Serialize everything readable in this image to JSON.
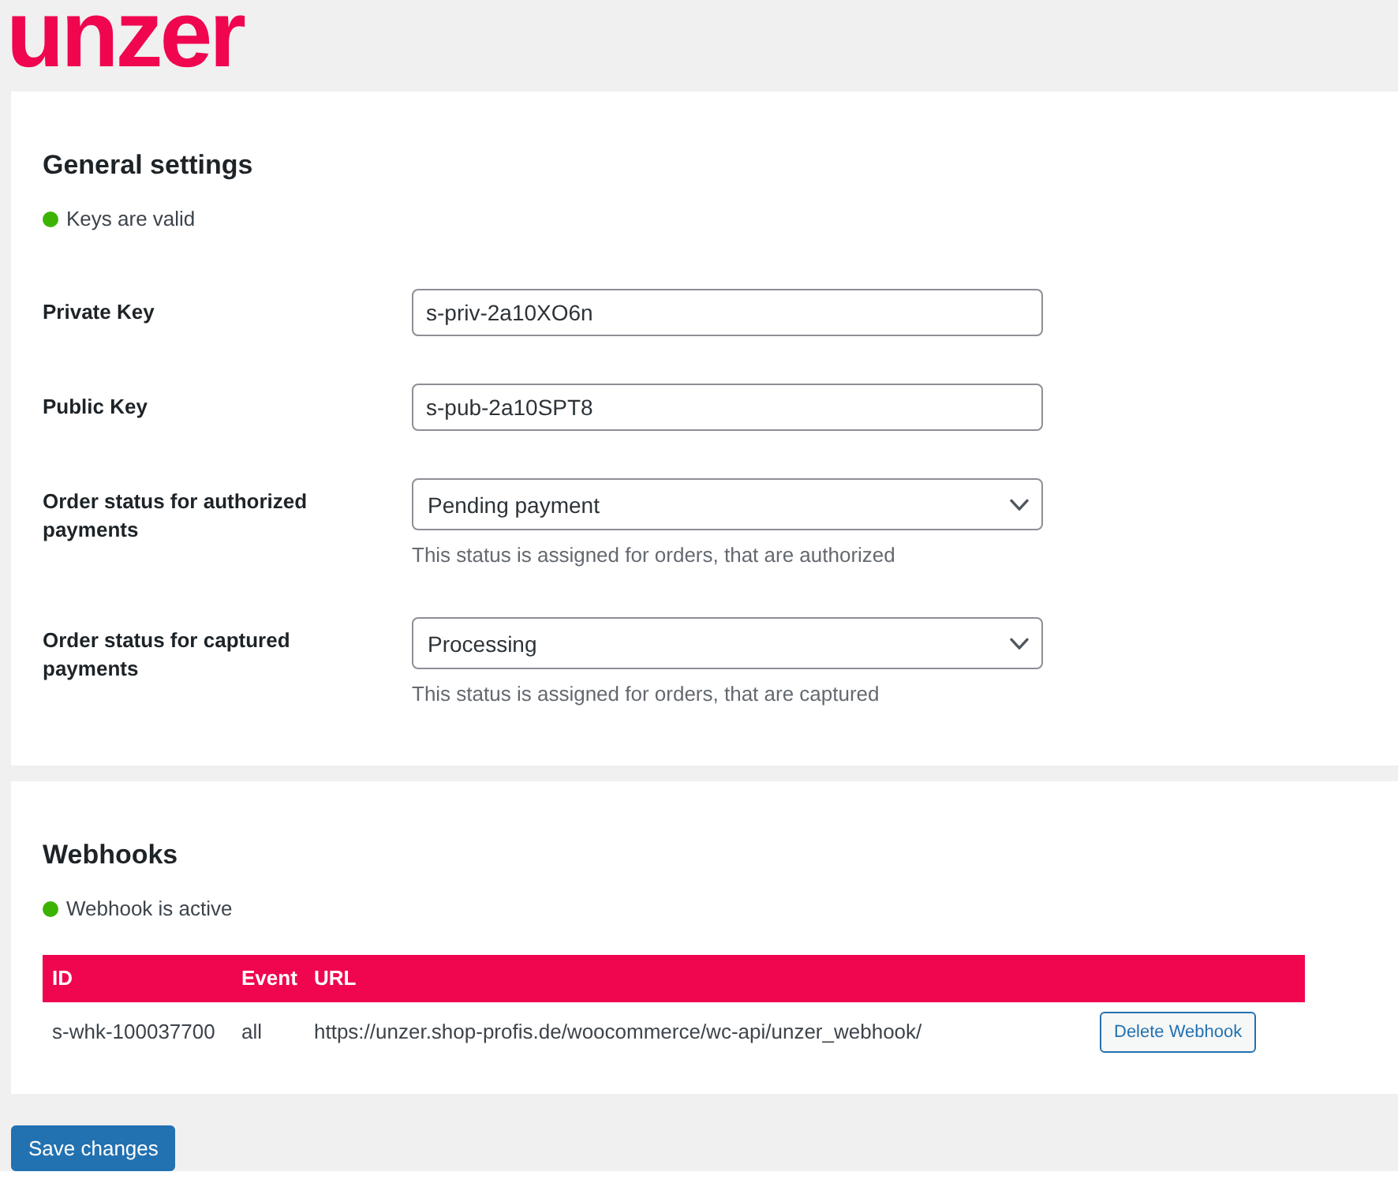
{
  "logo": {
    "text": "unzer"
  },
  "general_settings": {
    "title": "General settings",
    "status": {
      "text": "Keys are valid",
      "ok": true
    },
    "fields": [
      {
        "kind": "text",
        "label": "Private Key",
        "value": "s-priv-2a10XO6n"
      },
      {
        "kind": "text",
        "label": "Public Key",
        "value": "s-pub-2a10SPT8"
      },
      {
        "kind": "select",
        "label": "Order status for authorized payments",
        "value": "Pending payment",
        "description": "This status is assigned for orders, that are authorized"
      },
      {
        "kind": "select",
        "label": "Order status for captured payments",
        "value": "Processing",
        "description": "This status is assigned for orders, that are captured"
      }
    ]
  },
  "webhooks": {
    "title": "Webhooks",
    "status": {
      "text": "Webhook is active",
      "ok": true
    },
    "table": {
      "columns": [
        "ID",
        "Event",
        "URL"
      ],
      "rows": [
        {
          "cells": [
            "s-whk-100037700",
            "all",
            "https://unzer.shop-profis.de/woocommerce/wc-api/unzer_webhook/"
          ],
          "action": "Delete Webhook"
        }
      ]
    }
  },
  "save_button": {
    "label": "Save changes"
  }
}
